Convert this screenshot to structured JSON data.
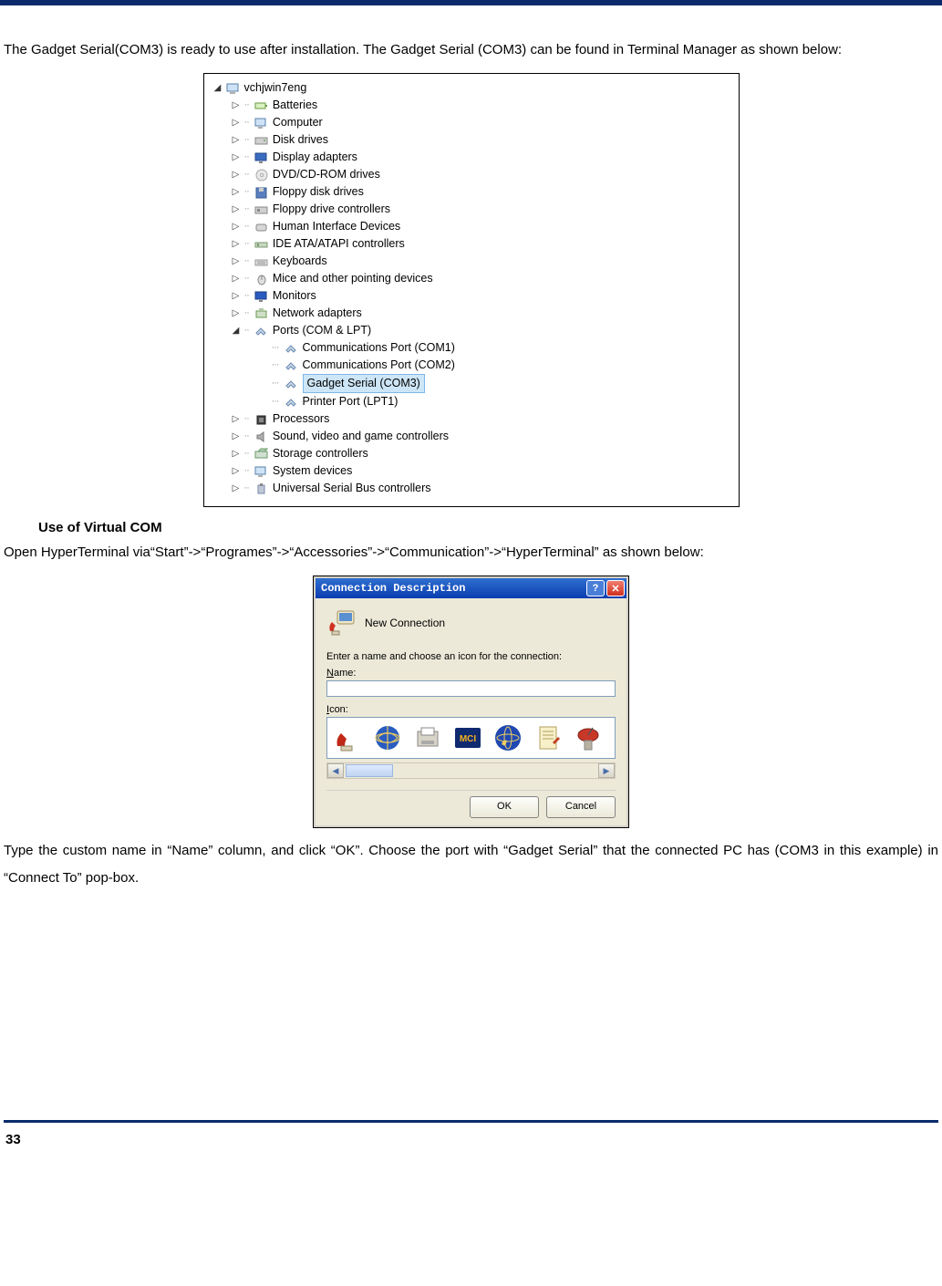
{
  "para1": "The Gadget Serial(COM3) is ready to use after installation. The Gadget Serial (COM3) can be found in Terminal Manager as shown below:",
  "section_heading": "Use of Virtual COM",
  "para2": "Open HyperTerminal via“Start”->“Programes”->“Accessories”->“Communication”->“HyperTerminal” as shown below:",
  "para3": "Type the custom name in “Name” column, and click “OK”. Choose the port with “Gadget Serial” that the connected PC has (COM3 in this example) in “Connect To” pop-box.",
  "devmgr": {
    "root": "vchjwin7eng",
    "items": [
      {
        "label": "Batteries",
        "glyph": "▷",
        "icon": "battery"
      },
      {
        "label": "Computer",
        "glyph": "▷",
        "icon": "computer"
      },
      {
        "label": "Disk drives",
        "glyph": "▷",
        "icon": "disk"
      },
      {
        "label": "Display adapters",
        "glyph": "▷",
        "icon": "display"
      },
      {
        "label": "DVD/CD-ROM drives",
        "glyph": "▷",
        "icon": "dvd"
      },
      {
        "label": "Floppy disk drives",
        "glyph": "▷",
        "icon": "floppy"
      },
      {
        "label": "Floppy drive controllers",
        "glyph": "▷",
        "icon": "floppyctl"
      },
      {
        "label": "Human Interface Devices",
        "glyph": "▷",
        "icon": "hid"
      },
      {
        "label": "IDE ATA/ATAPI controllers",
        "glyph": "▷",
        "icon": "ide"
      },
      {
        "label": "Keyboards",
        "glyph": "▷",
        "icon": "kbd"
      },
      {
        "label": "Mice and other pointing devices",
        "glyph": "▷",
        "icon": "mouse"
      },
      {
        "label": "Monitors",
        "glyph": "▷",
        "icon": "monitor"
      },
      {
        "label": "Network adapters",
        "glyph": "▷",
        "icon": "net"
      },
      {
        "label": "Ports (COM & LPT)",
        "glyph": "◢",
        "icon": "port",
        "children": [
          {
            "label": "Communications Port (COM1)",
            "icon": "port"
          },
          {
            "label": "Communications Port (COM2)",
            "icon": "port"
          },
          {
            "label": "Gadget Serial (COM3)",
            "icon": "port",
            "selected": true
          },
          {
            "label": "Printer Port (LPT1)",
            "icon": "port"
          }
        ]
      },
      {
        "label": "Processors",
        "glyph": "▷",
        "icon": "cpu"
      },
      {
        "label": "Sound, video and game controllers",
        "glyph": "▷",
        "icon": "sound"
      },
      {
        "label": "Storage controllers",
        "glyph": "▷",
        "icon": "storage"
      },
      {
        "label": "System devices",
        "glyph": "▷",
        "icon": "sys"
      },
      {
        "label": "Universal Serial Bus controllers",
        "glyph": "▷",
        "icon": "usb"
      }
    ]
  },
  "dialog": {
    "title": "Connection Description",
    "new_connection": "New Connection",
    "prompt": "Enter a name and choose an icon for the connection:",
    "name_label": "Name:",
    "icon_label": "Icon:",
    "name_value": "",
    "ok": "OK",
    "cancel": "Cancel",
    "icons": [
      "phone",
      "globe",
      "fax",
      "mci",
      "atomphone",
      "note",
      "dish"
    ]
  },
  "page_number": "33"
}
